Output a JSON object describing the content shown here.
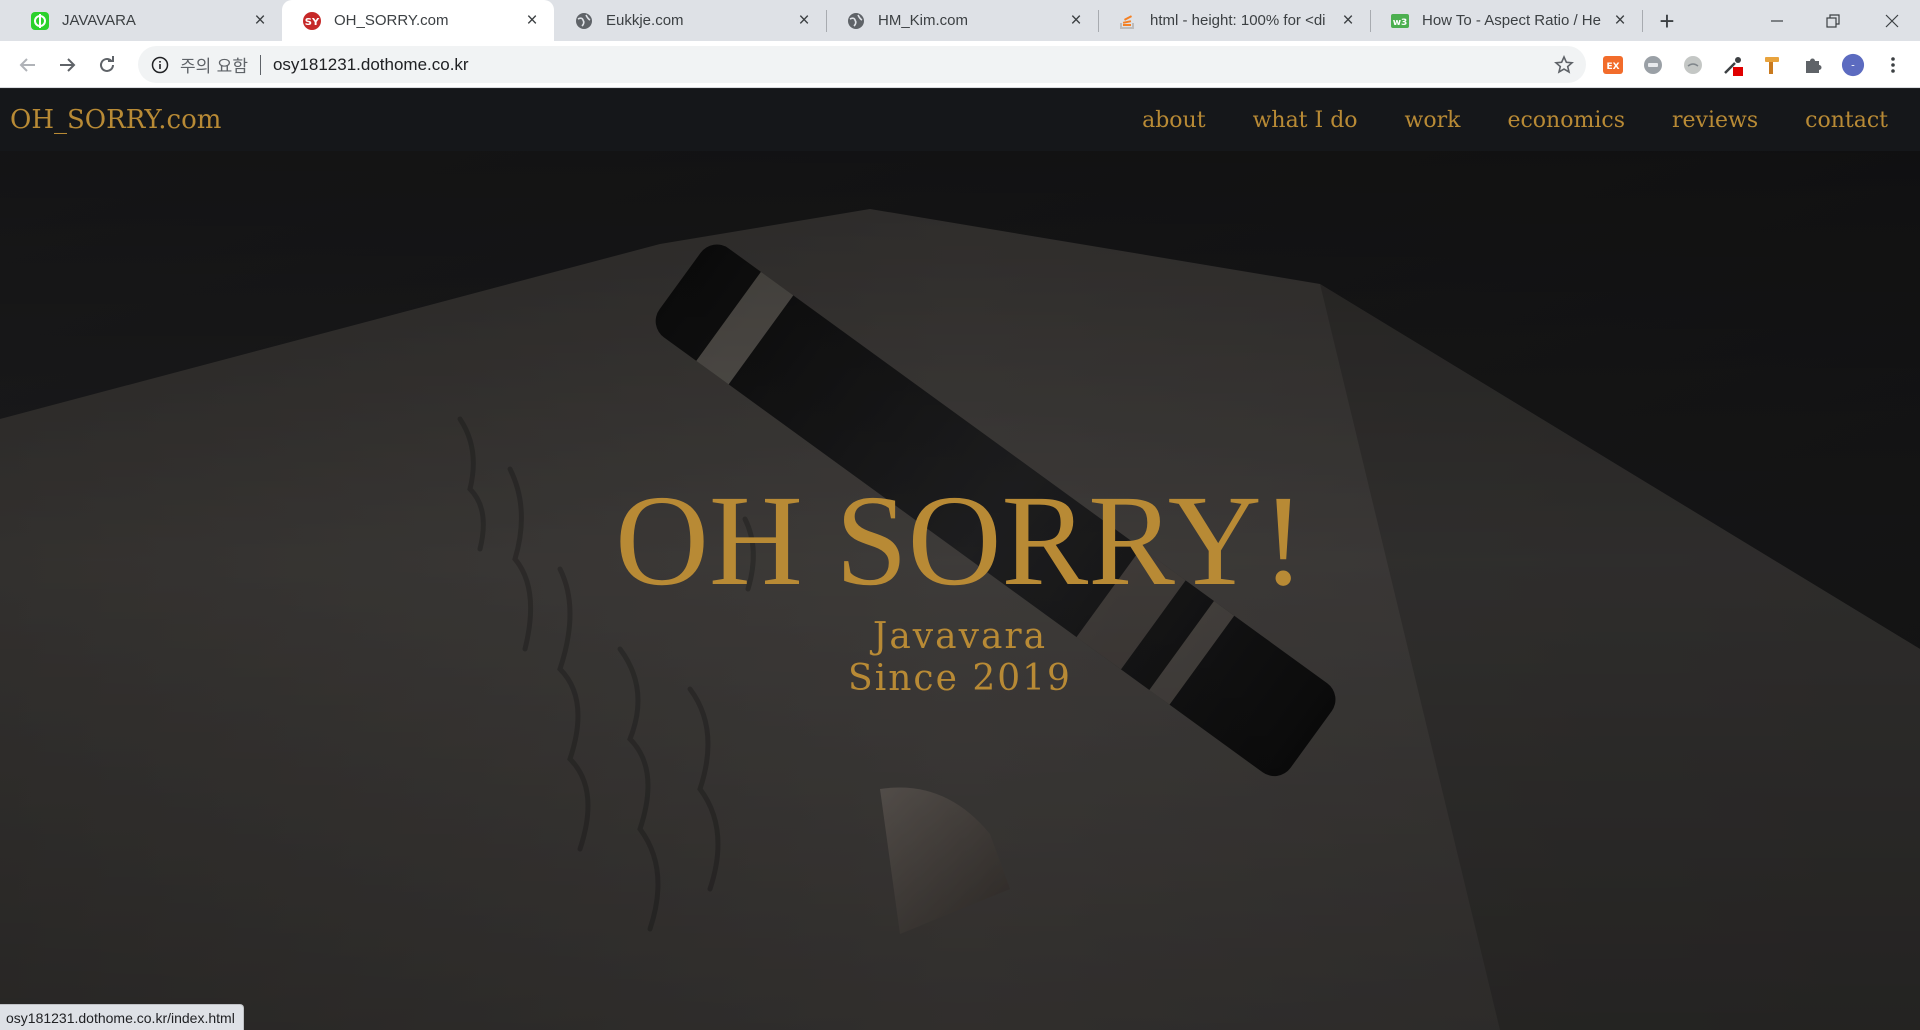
{
  "tabs": [
    {
      "title": "JAVAVARA",
      "icon": "javavara-favicon-icon",
      "active": false
    },
    {
      "title": "OH_SORRY.com",
      "icon": "oh-sorry-favicon-icon",
      "active": true
    },
    {
      "title": "Eukkje.com",
      "icon": "globe-icon",
      "active": false
    },
    {
      "title": "HM_Kim.com",
      "icon": "globe-icon",
      "active": false
    },
    {
      "title": "html - height: 100% for <di",
      "icon": "stackoverflow-icon",
      "active": false
    },
    {
      "title": "How To - Aspect Ratio / He",
      "icon": "w3schools-icon",
      "active": false
    }
  ],
  "address_bar": {
    "security_warning": "주의 요함",
    "url": "osy181231.dothome.co.kr"
  },
  "extensions": [
    {
      "name": "ex-extension-icon",
      "label": "EX",
      "color": "#f26c2b"
    },
    {
      "name": "gray-extension-icon",
      "label": "",
      "color": "#9aa0a6"
    },
    {
      "name": "circle-extension-icon",
      "label": "",
      "color": "#c4c7c5"
    },
    {
      "name": "eyedropper-extension-icon",
      "label": "",
      "color": "#d93025"
    },
    {
      "name": "hammer-extension-icon",
      "label": "",
      "color": "#e8a33d"
    },
    {
      "name": "puzzle-extensions-icon",
      "label": "",
      "color": "#5f6368"
    },
    {
      "name": "profile-avatar",
      "label": "-",
      "color": "#5c6bc0"
    },
    {
      "name": "kebab-menu-icon",
      "label": "",
      "color": "#5f6368"
    }
  ],
  "site": {
    "logo": "OH_SORRY.com",
    "nav": [
      "about",
      "what I do",
      "work",
      "economics",
      "reviews",
      "contact"
    ],
    "hero_title": "OH SORRY!",
    "hero_subtitle_1": "Javavara",
    "hero_subtitle_2": "Since 2019",
    "accent_color": "#b88a35"
  },
  "status_bar": {
    "link_url": "osy181231.dothome.co.kr/index.html"
  }
}
